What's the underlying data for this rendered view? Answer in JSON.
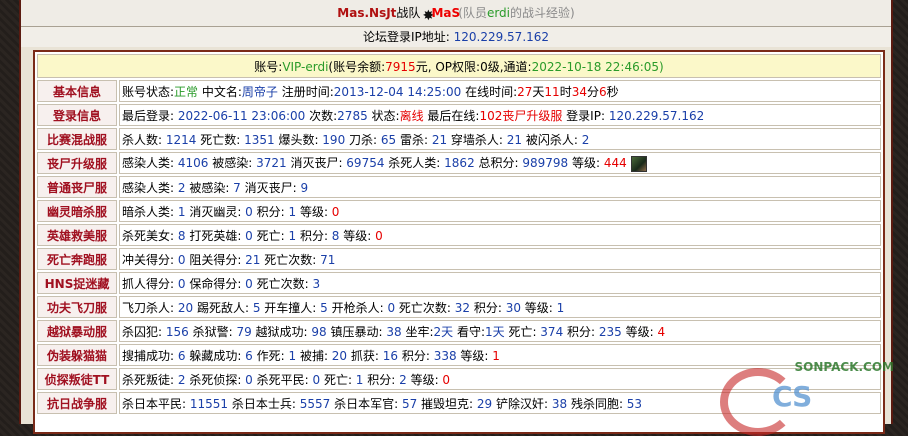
{
  "header": {
    "team_name": "Mas.NsJt",
    "team_suffix": "战队",
    "tag_text": "MaS",
    "member_prefix": "(队员",
    "member_name": "erdi",
    "member_suffix": "的战斗经验)"
  },
  "ipline": {
    "label": "论坛登录IP地址:",
    "ip": "120.229.57.162"
  },
  "account": {
    "prefix": "账号:",
    "name": "VIP-erdi",
    "balance_label": "(账号余额:",
    "balance": "7915",
    "balance_unit": "元,",
    "op_label": "OP权限:",
    "op_level": "0级,",
    "channel_label": "通道:",
    "channel": "2022-10-18 22:46:05)"
  },
  "rows": [
    {
      "label": "基本信息",
      "parts": [
        {
          "t": "账号状态:"
        },
        {
          "t": "正常",
          "c": "green"
        },
        {
          "t": " 中文名:"
        },
        {
          "t": "周帝子",
          "c": "blue"
        },
        {
          "t": " 注册时间:"
        },
        {
          "t": "2013-12-04 14:25:00",
          "c": "blue"
        },
        {
          "t": " 在线时间:"
        },
        {
          "t": "27",
          "c": "red"
        },
        {
          "t": "天"
        },
        {
          "t": "11",
          "c": "red"
        },
        {
          "t": "时"
        },
        {
          "t": "34",
          "c": "red"
        },
        {
          "t": "分"
        },
        {
          "t": "6",
          "c": "red"
        },
        {
          "t": "秒"
        }
      ]
    },
    {
      "label": "登录信息",
      "parts": [
        {
          "t": "最后登录:"
        },
        {
          "t": " 2022-06-11 23:06:00",
          "c": "blue"
        },
        {
          "t": " 次数:"
        },
        {
          "t": "2785",
          "c": "blue"
        },
        {
          "t": " 状态:"
        },
        {
          "t": "离线",
          "c": "red"
        },
        {
          "t": " 最后在线:"
        },
        {
          "t": "102丧尸升级服",
          "c": "red"
        },
        {
          "t": " 登录IP:"
        },
        {
          "t": " 120.229.57.162",
          "c": "blue"
        }
      ]
    },
    {
      "label": "比赛混战服",
      "parts": [
        {
          "t": "杀人数:"
        },
        {
          "t": " 1214",
          "c": "blue"
        },
        {
          "t": " 死亡数:"
        },
        {
          "t": " 1351",
          "c": "blue"
        },
        {
          "t": " 爆头数:"
        },
        {
          "t": " 190",
          "c": "blue"
        },
        {
          "t": " 刀杀:"
        },
        {
          "t": " 65",
          "c": "blue"
        },
        {
          "t": " 雷杀:"
        },
        {
          "t": " 21",
          "c": "blue"
        },
        {
          "t": " 穿墙杀人:"
        },
        {
          "t": " 21",
          "c": "blue"
        },
        {
          "t": " 被闪杀人:"
        },
        {
          "t": " 2",
          "c": "blue"
        }
      ]
    },
    {
      "label": "丧尸升级服",
      "icon": true,
      "parts": [
        {
          "t": "感染人类:"
        },
        {
          "t": " 4106",
          "c": "blue"
        },
        {
          "t": " 被感染:"
        },
        {
          "t": " 3721",
          "c": "blue"
        },
        {
          "t": " 消灭丧尸:"
        },
        {
          "t": " 69754",
          "c": "blue"
        },
        {
          "t": " 杀死人类:"
        },
        {
          "t": " 1862",
          "c": "blue"
        },
        {
          "t": " 总积分:"
        },
        {
          "t": " 989798",
          "c": "blue"
        },
        {
          "t": " 等级:"
        },
        {
          "t": " 444",
          "c": "red"
        }
      ]
    },
    {
      "label": "普通丧尸服",
      "parts": [
        {
          "t": "感染人类:"
        },
        {
          "t": " 2",
          "c": "blue"
        },
        {
          "t": " 被感染:"
        },
        {
          "t": " 7",
          "c": "blue"
        },
        {
          "t": " 消灭丧尸:"
        },
        {
          "t": " 9",
          "c": "blue"
        }
      ]
    },
    {
      "label": "幽灵暗杀服",
      "parts": [
        {
          "t": "暗杀人类:"
        },
        {
          "t": " 1",
          "c": "blue"
        },
        {
          "t": " 消灭幽灵:"
        },
        {
          "t": " 0",
          "c": "blue"
        },
        {
          "t": " 积分:"
        },
        {
          "t": " 1",
          "c": "blue"
        },
        {
          "t": " 等级:"
        },
        {
          "t": " 0",
          "c": "red"
        }
      ]
    },
    {
      "label": "英雄救美服",
      "parts": [
        {
          "t": "杀死美女:"
        },
        {
          "t": " 8",
          "c": "blue"
        },
        {
          "t": " 打死英雄:"
        },
        {
          "t": " 0",
          "c": "blue"
        },
        {
          "t": " 死亡:"
        },
        {
          "t": " 1",
          "c": "blue"
        },
        {
          "t": " 积分:"
        },
        {
          "t": " 8",
          "c": "blue"
        },
        {
          "t": " 等级:"
        },
        {
          "t": " 0",
          "c": "red"
        }
      ]
    },
    {
      "label": "死亡奔跑服",
      "parts": [
        {
          "t": "冲关得分:"
        },
        {
          "t": " 0",
          "c": "blue"
        },
        {
          "t": " 阻关得分:"
        },
        {
          "t": " 21",
          "c": "blue"
        },
        {
          "t": " 死亡次数:"
        },
        {
          "t": " 71",
          "c": "blue"
        }
      ]
    },
    {
      "label": "HNS捉迷藏",
      "parts": [
        {
          "t": "抓人得分:"
        },
        {
          "t": " 0",
          "c": "blue"
        },
        {
          "t": " 保命得分:"
        },
        {
          "t": " 0",
          "c": "blue"
        },
        {
          "t": " 死亡次数:"
        },
        {
          "t": " 3",
          "c": "blue"
        }
      ]
    },
    {
      "label": "功夫飞刀服",
      "parts": [
        {
          "t": "飞刀杀人:"
        },
        {
          "t": " 20",
          "c": "blue"
        },
        {
          "t": " 踢死敌人:"
        },
        {
          "t": " 5",
          "c": "blue"
        },
        {
          "t": " 开车撞人:"
        },
        {
          "t": " 5",
          "c": "blue"
        },
        {
          "t": " 开枪杀人:"
        },
        {
          "t": " 0",
          "c": "blue"
        },
        {
          "t": " 死亡次数:"
        },
        {
          "t": " 32",
          "c": "blue"
        },
        {
          "t": " 积分:"
        },
        {
          "t": " 30",
          "c": "blue"
        },
        {
          "t": " 等级:"
        },
        {
          "t": " 1",
          "c": "blue"
        }
      ]
    },
    {
      "label": "越狱暴动服",
      "parts": [
        {
          "t": "杀囚犯:"
        },
        {
          "t": " 156",
          "c": "blue"
        },
        {
          "t": " 杀狱警:"
        },
        {
          "t": " 79",
          "c": "blue"
        },
        {
          "t": " 越狱成功:"
        },
        {
          "t": " 98",
          "c": "blue"
        },
        {
          "t": " 镇压暴动:"
        },
        {
          "t": " 38",
          "c": "blue"
        },
        {
          "t": " 坐牢:"
        },
        {
          "t": "2天",
          "c": "blue"
        },
        {
          "t": " 看守:"
        },
        {
          "t": "1天",
          "c": "blue"
        },
        {
          "t": " 死亡:"
        },
        {
          "t": " 374",
          "c": "blue"
        },
        {
          "t": " 积分:"
        },
        {
          "t": " 235",
          "c": "blue"
        },
        {
          "t": " 等级:"
        },
        {
          "t": " 4",
          "c": "red"
        }
      ]
    },
    {
      "label": "伪装躲猫猫",
      "parts": [
        {
          "t": "搜捕成功:"
        },
        {
          "t": " 6",
          "c": "blue"
        },
        {
          "t": " 躲藏成功:"
        },
        {
          "t": " 6",
          "c": "blue"
        },
        {
          "t": " 作死:"
        },
        {
          "t": " 1",
          "c": "blue"
        },
        {
          "t": " 被捕:"
        },
        {
          "t": " 20",
          "c": "blue"
        },
        {
          "t": " 抓获:"
        },
        {
          "t": " 16",
          "c": "blue"
        },
        {
          "t": " 积分:"
        },
        {
          "t": " 338",
          "c": "blue"
        },
        {
          "t": " 等级:"
        },
        {
          "t": " 1",
          "c": "red"
        }
      ]
    },
    {
      "label": "侦探叛徒TT",
      "parts": [
        {
          "t": "杀死叛徒:"
        },
        {
          "t": " 2",
          "c": "blue"
        },
        {
          "t": " 杀死侦探:"
        },
        {
          "t": " 0",
          "c": "blue"
        },
        {
          "t": " 杀死平民:"
        },
        {
          "t": " 0",
          "c": "blue"
        },
        {
          "t": " 死亡:"
        },
        {
          "t": " 1",
          "c": "blue"
        },
        {
          "t": " 积分:"
        },
        {
          "t": " 2",
          "c": "blue"
        },
        {
          "t": " 等级:"
        },
        {
          "t": " 0",
          "c": "red"
        }
      ]
    },
    {
      "label": "抗日战争服",
      "parts": [
        {
          "t": "杀日本平民:"
        },
        {
          "t": " 11551",
          "c": "blue"
        },
        {
          "t": " 杀日本士兵:"
        },
        {
          "t": " 5557",
          "c": "blue"
        },
        {
          "t": " 杀日本军官:"
        },
        {
          "t": " 57",
          "c": "blue"
        },
        {
          "t": " 摧毁坦克:"
        },
        {
          "t": " 29",
          "c": "blue"
        },
        {
          "t": " 铲除汉奸:"
        },
        {
          "t": " 38",
          "c": "blue"
        },
        {
          "t": " 残杀同胞:"
        },
        {
          "t": " 53",
          "c": "blue"
        }
      ]
    }
  ],
  "watermark": {
    "site": "SONPACK.COM",
    "logo": "CS"
  }
}
